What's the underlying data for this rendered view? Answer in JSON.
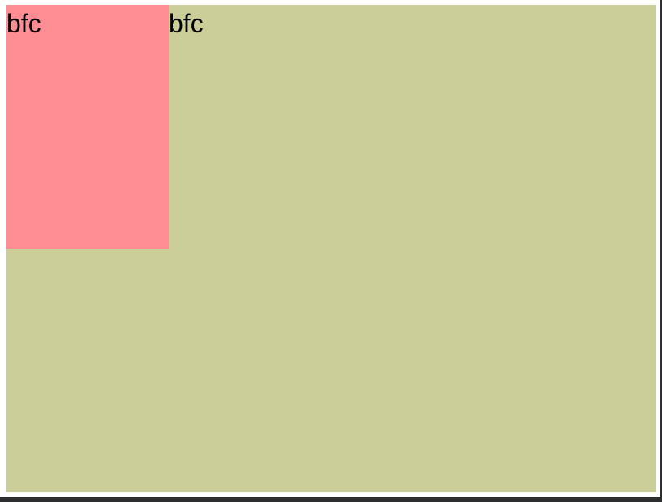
{
  "demo": {
    "float_box_text": "bfc",
    "container_text": "bfc"
  },
  "colors": {
    "frame_background": "#2c2e30",
    "page_background": "#ffffff",
    "container_background": "#cbce99",
    "float_box_background": "#ff8e94",
    "text_color": "#000000"
  }
}
